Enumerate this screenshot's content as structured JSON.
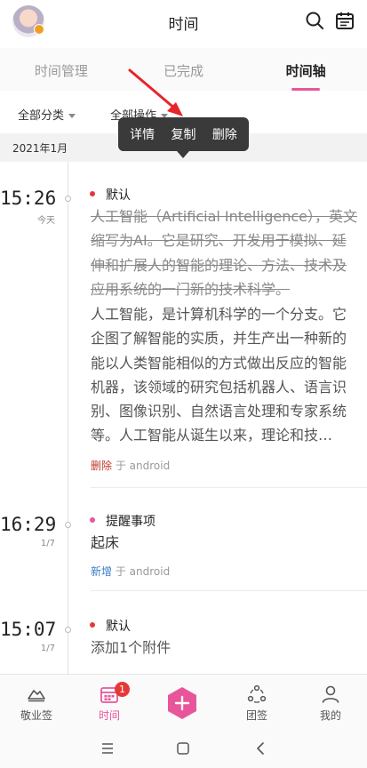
{
  "header": {
    "title": "时间"
  },
  "tabs": [
    {
      "label": "时间管理"
    },
    {
      "label": "已完成"
    },
    {
      "label": "时间轴"
    }
  ],
  "filters": {
    "category": "全部分类",
    "operation": "全部操作"
  },
  "month": "2021年1月",
  "popup_menu": {
    "items": [
      "详情",
      "复制",
      "删除"
    ]
  },
  "entries": [
    {
      "time": "15:26",
      "sub": "今天",
      "category": "默认",
      "category_color": "#e53935",
      "content_strike": "人工智能（Artificial Intelligence），英文缩写为AI。它是研究、开发用于模拟、延伸和扩展人的智能的理论、方法、技术及应用系统的一门新的技术科学。",
      "content_plain": "人工智能，是计算机科学的一个分支。它企图了解智能的实质，并生产出一种新的能以人类智能相似的方式做出反应的智能机器，该领域的研究包括机器人、语言识别、图像识别、自然语言处理和专家系统等。人工智能从诞生以来，理论和技…",
      "op": "删除",
      "op_color": "#c0392b",
      "source": "于 android"
    },
    {
      "time": "16:29",
      "sub": "1/7",
      "category": "提醒事项",
      "category_color": "#e8559a",
      "content": "起床",
      "op": "新增",
      "op_color": "#3a7cc4",
      "source": "于 android"
    },
    {
      "time": "15:07",
      "sub": "1/7",
      "category": "默认",
      "category_color": "#e53935",
      "content": "添加1个附件"
    }
  ],
  "bottom_nav": [
    {
      "label": "敬业签",
      "icon": "cloud-note-icon"
    },
    {
      "label": "时间",
      "icon": "calendar-icon",
      "badge": "1"
    },
    {
      "label": "",
      "icon": "plus-icon"
    },
    {
      "label": "团签",
      "icon": "team-icon"
    },
    {
      "label": "我的",
      "icon": "person-icon"
    }
  ],
  "colors": {
    "accent": "#e8559a",
    "popup_bg": "#3a3a3a"
  }
}
